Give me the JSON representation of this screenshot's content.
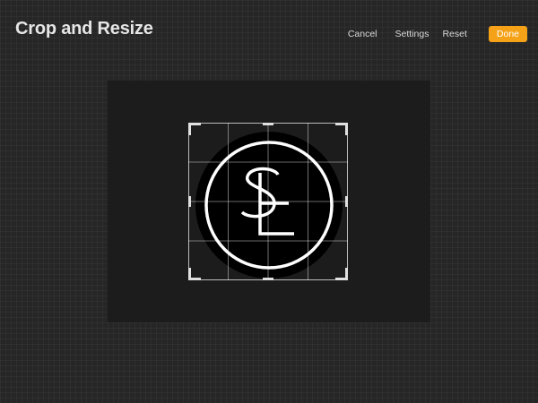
{
  "header": {
    "title": "Crop and Resize"
  },
  "toolbar": {
    "cancel_label": "Cancel",
    "settings_label": "Settings",
    "reset_label": "Reset",
    "done_label": "Done"
  },
  "canvas": {
    "logo_text": "SL"
  },
  "colors": {
    "accent": "#f5a219",
    "background": "#262626",
    "canvas": "#1c1c1c"
  }
}
